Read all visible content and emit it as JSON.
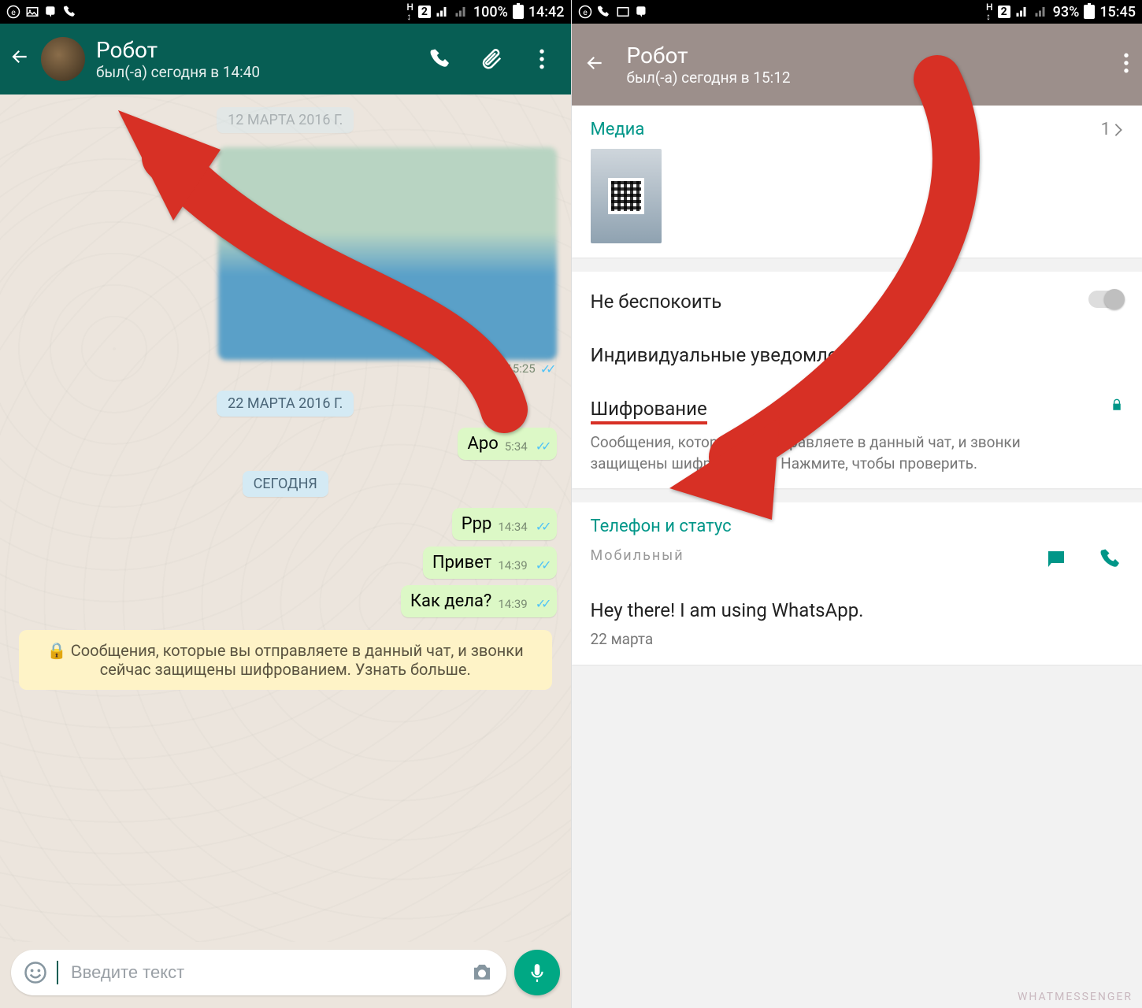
{
  "left": {
    "status": {
      "battery": "100%",
      "time": "14:42",
      "sim": "2"
    },
    "header": {
      "name": "Робот",
      "lastseen": "был(-а) сегодня в 14:40"
    },
    "dates": {
      "d0": "12 МАРТА 2016 Г.",
      "d1": "22 МАРТА 2016 Г.",
      "d2": "СЕГОДНЯ"
    },
    "map_time": "15:25",
    "messages": [
      {
        "text": "Аро",
        "time": "5:34"
      },
      {
        "text": "Ppp",
        "time": "14:34"
      },
      {
        "text": "Привет",
        "time": "14:39"
      },
      {
        "text": "Как дела?",
        "time": "14:39"
      }
    ],
    "notice": "Сообщения, которые вы отправляете в данный чат, и звонки сейчас защищены шифрованием. Узнать больше.",
    "input_placeholder": "Введите текст"
  },
  "right": {
    "status": {
      "battery": "93%",
      "time": "15:45",
      "sim": "2"
    },
    "header": {
      "name": "Робот",
      "lastseen": "был(-а) сегодня в 15:12"
    },
    "media": {
      "label": "Медиа",
      "count": "1"
    },
    "dnd": "Не беспокоить",
    "custom_notif": "Индивидуальные уведомления",
    "encryption": {
      "title": "Шифрование",
      "desc": "Сообщения, которые вы отправляете в данный чат, и звонки защищены шифрованием. Нажмите, чтобы проверить."
    },
    "phone_section": "Телефон и статус",
    "phone_label": "Мобильный",
    "about": {
      "text": "Hey there! I am using WhatsApp.",
      "date": "22 марта"
    }
  },
  "watermark": "WHATMESSENGER"
}
